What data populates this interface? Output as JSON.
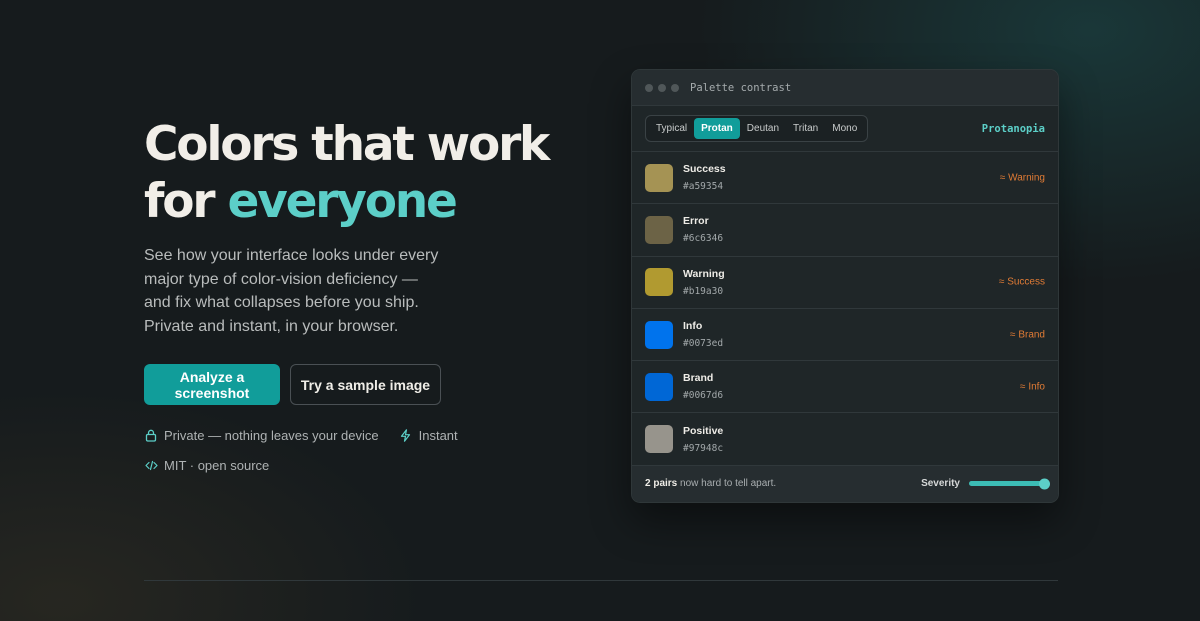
{
  "hero": {
    "title_line1": "Colors that work",
    "title_line2_prefix": "for ",
    "title_line2_accent": "everyone",
    "description": "See how your interface looks under every major type of color-vision deficiency — and fix what collapses before you ship. Private and instant, in your browser.",
    "primary_button": "Analyze a screenshot",
    "secondary_button": "Try a sample image",
    "features": [
      {
        "icon": "lock-icon",
        "label": "Private — nothing leaves your device"
      },
      {
        "icon": "bolt-icon",
        "label": "Instant"
      },
      {
        "icon": "code-icon",
        "label": "MIT · open source"
      }
    ]
  },
  "panel": {
    "title": "Palette contrast",
    "modes": [
      "Typical",
      "Protan",
      "Deutan",
      "Tritan",
      "Mono"
    ],
    "active_mode": "Protan",
    "simulation_label": "Protanopia",
    "colors": [
      {
        "name": "Success",
        "hex": "#a59354",
        "warning": "≈ Warning"
      },
      {
        "name": "Error",
        "hex": "#6c6346",
        "warning": ""
      },
      {
        "name": "Warning",
        "hex": "#b19a30",
        "warning": "≈ Success"
      },
      {
        "name": "Info",
        "hex": "#0073ed",
        "warning": "≈ Brand"
      },
      {
        "name": "Brand",
        "hex": "#0067d6",
        "warning": "≈ Info"
      },
      {
        "name": "Positive",
        "hex": "#97948c",
        "warning": ""
      }
    ],
    "footer": {
      "pairs": "2 pairs",
      "pairs_suffix": " now hard to tell apart.",
      "severity_label": "Severity",
      "severity_value": 1.0
    }
  },
  "colors": {
    "accent": "#5ccfc8",
    "primary": "#119d9a",
    "warning_text": "#e07b35"
  }
}
